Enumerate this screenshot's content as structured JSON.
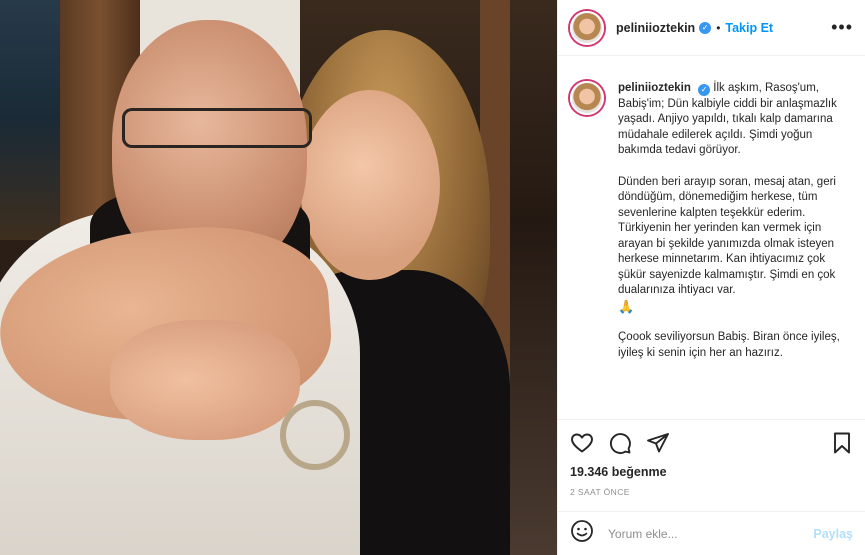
{
  "header": {
    "username": "peliniioztekin",
    "separator": "•",
    "follow_label": "Takip Et",
    "more_label": "•••"
  },
  "caption": {
    "username": "peliniioztekin",
    "paragraph1": "İlk aşkım, Rasoş'um, Babiş'im; Dün kalbiyle ciddi bir anlaşmazlık yaşadı. Anjiyo yapıldı, tıkalı kalp damarına müdahale edilerek açıldı. Şimdi yoğun bakımda tedavi görüyor.",
    "paragraph2": "Dünden beri arayıp soran, mesaj atan, geri döndüğüm, dönemediğim herkese, tüm sevenlerine kalpten teşekkür ederim. Türkiyenin her yerinden kan vermek için arayan bi şekilde yanımızda olmak isteyen herkese minnetarım. Kan ihtiyacımız çok şükür sayenizde kalmamıştır. Şimdi en çok dualarınıza ihtiyacı var.",
    "emoji": "🙏",
    "paragraph3": "Çoook seviliyorsun Babiş. Biran önce iyileş, iyileş ki senin için her an hazırız."
  },
  "actions": {
    "icons": [
      "heart-icon",
      "comment-icon",
      "share-icon",
      "bookmark-icon"
    ]
  },
  "likes": "19.346 beğenme",
  "timestamp": "2 SAAT ÖNCE",
  "comment_box": {
    "placeholder": "Yorum ekle...",
    "post_label": "Paylaş"
  },
  "colors": {
    "accent": "#0095f6",
    "verified": "#3897f0",
    "story_ring": "#d3356f",
    "muted": "#8e8e8e"
  }
}
